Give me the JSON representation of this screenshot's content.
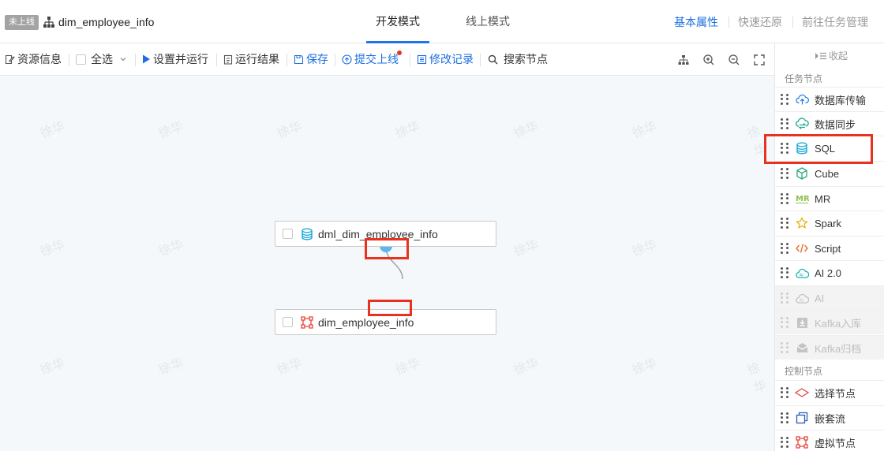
{
  "header": {
    "status_badge": "未上线",
    "flow_name": "dim_employee_info",
    "tabs": [
      {
        "label": "开发模式",
        "active": true
      },
      {
        "label": "线上模式",
        "active": false
      }
    ],
    "links": {
      "basic_props": "基本属性",
      "quick_restore": "快速还原",
      "task_management": "前往任务管理"
    }
  },
  "toolbar": {
    "resource_info": "资源信息",
    "select_all": "全选",
    "set_and_run": "设置并运行",
    "run_result": "运行结果",
    "save": "保存",
    "submit_online": "提交上线",
    "modify_record": "修改记录",
    "search_node": "搜索节点",
    "icons": [
      "org-chart-icon",
      "zoom-in-icon",
      "zoom-out-icon",
      "fullscreen-icon"
    ]
  },
  "canvas": {
    "watermark_text": "徐华",
    "nodes": [
      {
        "label": "dml_dim_employee_info",
        "icon": "database-icon"
      },
      {
        "label": "dim_employee_info",
        "icon": "virtual-node-icon"
      }
    ]
  },
  "panel": {
    "collapse_label": "收起",
    "task_section_title": "任务节点",
    "task_nodes": [
      {
        "label": "数据库传输",
        "icon": "upload-cloud-icon",
        "disabled": false
      },
      {
        "label": "数据同步",
        "icon": "sync-cloud-icon",
        "disabled": false
      },
      {
        "label": "SQL",
        "icon": "database-icon",
        "disabled": false
      },
      {
        "label": "Cube",
        "icon": "cube-icon",
        "disabled": false
      },
      {
        "label": "MR",
        "icon": "mr-icon",
        "disabled": false
      },
      {
        "label": "Spark",
        "icon": "star-icon",
        "disabled": false
      },
      {
        "label": "Script",
        "icon": "code-icon",
        "disabled": false
      },
      {
        "label": "AI 2.0",
        "icon": "ai-cloud-icon",
        "disabled": false
      },
      {
        "label": "AI",
        "icon": "ai-cloud-icon",
        "disabled": true
      },
      {
        "label": "Kafka入库",
        "icon": "kafka-import-icon",
        "disabled": true
      },
      {
        "label": "Kafka归档",
        "icon": "kafka-archive-icon",
        "disabled": true
      }
    ],
    "control_section_title": "控制节点",
    "control_nodes": [
      {
        "label": "选择节点",
        "icon": "diamond-icon"
      },
      {
        "label": "嵌套流",
        "icon": "nested-flow-icon"
      },
      {
        "label": "虚拟节点",
        "icon": "virtual-node-icon"
      }
    ]
  },
  "colors": {
    "accent": "#1d6fe0",
    "highlight_box": "#e8321f",
    "canvas_bg": "#f5f8fb"
  }
}
